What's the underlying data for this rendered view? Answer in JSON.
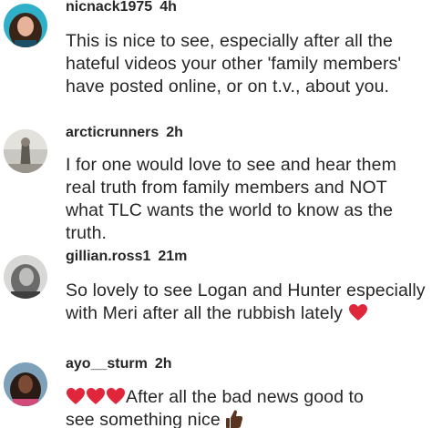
{
  "comments": [
    {
      "username": "nicnack1975",
      "time": "4h",
      "text": "This is nice to see, especially after all the hateful videos your other 'family members' have posted online, or on t.v., about you."
    },
    {
      "username": "arcticrunners",
      "time": "2h",
      "text": "I for one would love to see and hear them real truth from family members and NOT what TLC wants the world to know as the truth."
    },
    {
      "username": "gillian.ross1",
      "time": "21m",
      "text": "So lovely to see Logan and Hunter especially with Meri after all the rubbish lately",
      "trailing_emoji": "red-heart"
    },
    {
      "username": "ayo__sturm",
      "time": "2h",
      "leading_emojis": [
        "red-heart",
        "red-heart",
        "red-heart"
      ],
      "text_line1": "After all the bad news good to",
      "text_line2": "see something nice",
      "trailing_emoji": "thumbs-up-dark-skin"
    }
  ],
  "colors": {
    "text": "#262626",
    "heart": "#e0263a",
    "background": "#ffffff"
  }
}
